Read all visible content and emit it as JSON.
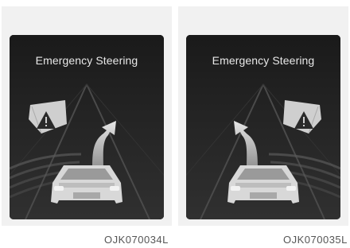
{
  "panels": [
    {
      "title": "Emergency Steering",
      "caption": "OJK070034L",
      "steer_direction": "right",
      "warning_side": "left"
    },
    {
      "title": "Emergency Steering",
      "caption": "OJK070035L",
      "steer_direction": "left",
      "warning_side": "right"
    }
  ],
  "icons": {
    "warning": "warning-triangle-icon",
    "arrow": "steering-arrow-icon",
    "car": "vehicle-rear-icon"
  },
  "colors": {
    "screen_bg": "#1b1b1b",
    "title_text": "#e8e8e8",
    "panel_bg": "#f1f1f1"
  }
}
